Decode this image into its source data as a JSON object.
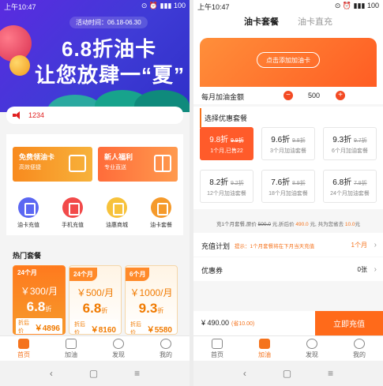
{
  "left": {
    "status": {
      "time": "上午10:47",
      "icons": "⊙ ⏰ ▮▮▮ 100"
    },
    "banner": {
      "period": "活动时间：06.18-06.30",
      "headline": "6.8折油卡",
      "subline": "让您放肆一“夏”"
    },
    "notice": {
      "text": "1234"
    },
    "promos": [
      {
        "title": "免费领油卡",
        "sub": "高效便捷"
      },
      {
        "title": "新人福利",
        "sub": "专业直送"
      }
    ],
    "services": [
      {
        "label": "油卡充值",
        "color": "#5b67f2"
      },
      {
        "label": "手机充值",
        "color": "#f24a4a"
      },
      {
        "label": "油惠商城",
        "color": "#f7c23b"
      },
      {
        "label": "油卡套餐",
        "color": "#f59a2b"
      }
    ],
    "hot": {
      "title": "热门套餐",
      "cards": [
        {
          "months": "24个月",
          "price": "￥300/月",
          "discount": "6.8",
          "unit": "折",
          "fold_label": "折后价",
          "fold_price": "￥4896"
        },
        {
          "months": "24个月",
          "price": "￥500/月",
          "discount": "6.8",
          "unit": "折",
          "fold_label": "折后价",
          "fold_price": "￥8160"
        },
        {
          "months": "6个月",
          "price": "￥1000/月",
          "discount": "9.3",
          "unit": "折",
          "fold_label": "折后价",
          "fold_price": "￥5580"
        }
      ]
    },
    "tabbar": [
      {
        "label": "首页",
        "active": true
      },
      {
        "label": "加油",
        "active": false
      },
      {
        "label": "发现",
        "active": false
      },
      {
        "label": "我的",
        "active": false
      }
    ]
  },
  "right": {
    "status": {
      "time": "上午10:47",
      "icons": "⊙ ⏰ ▮▮▮ 100"
    },
    "tabs": [
      {
        "label": "油卡套餐",
        "active": true
      },
      {
        "label": "油卡直充",
        "active": false
      }
    ],
    "hero": {
      "button": "点击添加加油卡"
    },
    "amount": {
      "label": "每月加油金额",
      "value": "500",
      "minus": "−",
      "plus": "+"
    },
    "packages": {
      "title": "选择优惠套餐",
      "items": [
        {
          "discount": "9.8折",
          "orig": "9.9折",
          "desc": "1个月,已售22",
          "selected": true
        },
        {
          "discount": "9.6折",
          "orig": "9.8折",
          "desc": "3个月加油套餐",
          "selected": false
        },
        {
          "discount": "9.3折",
          "orig": "9.7折",
          "desc": "6个月加油套餐",
          "selected": false
        },
        {
          "discount": "8.2折",
          "orig": "9.2折",
          "desc": "12个月加油套餐",
          "selected": false
        },
        {
          "discount": "7.6折",
          "orig": "8.9折",
          "desc": "18个月加油套餐",
          "selected": false
        },
        {
          "discount": "6.8折",
          "orig": "7.9折",
          "desc": "24个月加油套餐",
          "selected": false
        }
      ]
    },
    "summary": {
      "p1": "充1个月套餐,原价 ",
      "orig": "500.0",
      "p2": " 元,折后价 ",
      "after": "490.0",
      "p3": " 元, 共为您省去 ",
      "saved": "10.0",
      "p4": "元"
    },
    "plan": {
      "label": "充值计划",
      "hint": "提示：1个月套餐将在下月当天充值",
      "value": "1个月",
      "chevron": "›"
    },
    "coupon": {
      "label": "优惠券",
      "value": "0张",
      "chevron": "›"
    },
    "pay": {
      "amount": "¥ 490.00",
      "save": "(省10.00)",
      "button": "立即充值"
    },
    "tabbar": [
      {
        "label": "首页",
        "active": false
      },
      {
        "label": "加油",
        "active": true
      },
      {
        "label": "发现",
        "active": false
      },
      {
        "label": "我的",
        "active": false
      }
    ]
  },
  "system_nav": {
    "back": "‹",
    "home": "▢",
    "menu": "≡"
  }
}
